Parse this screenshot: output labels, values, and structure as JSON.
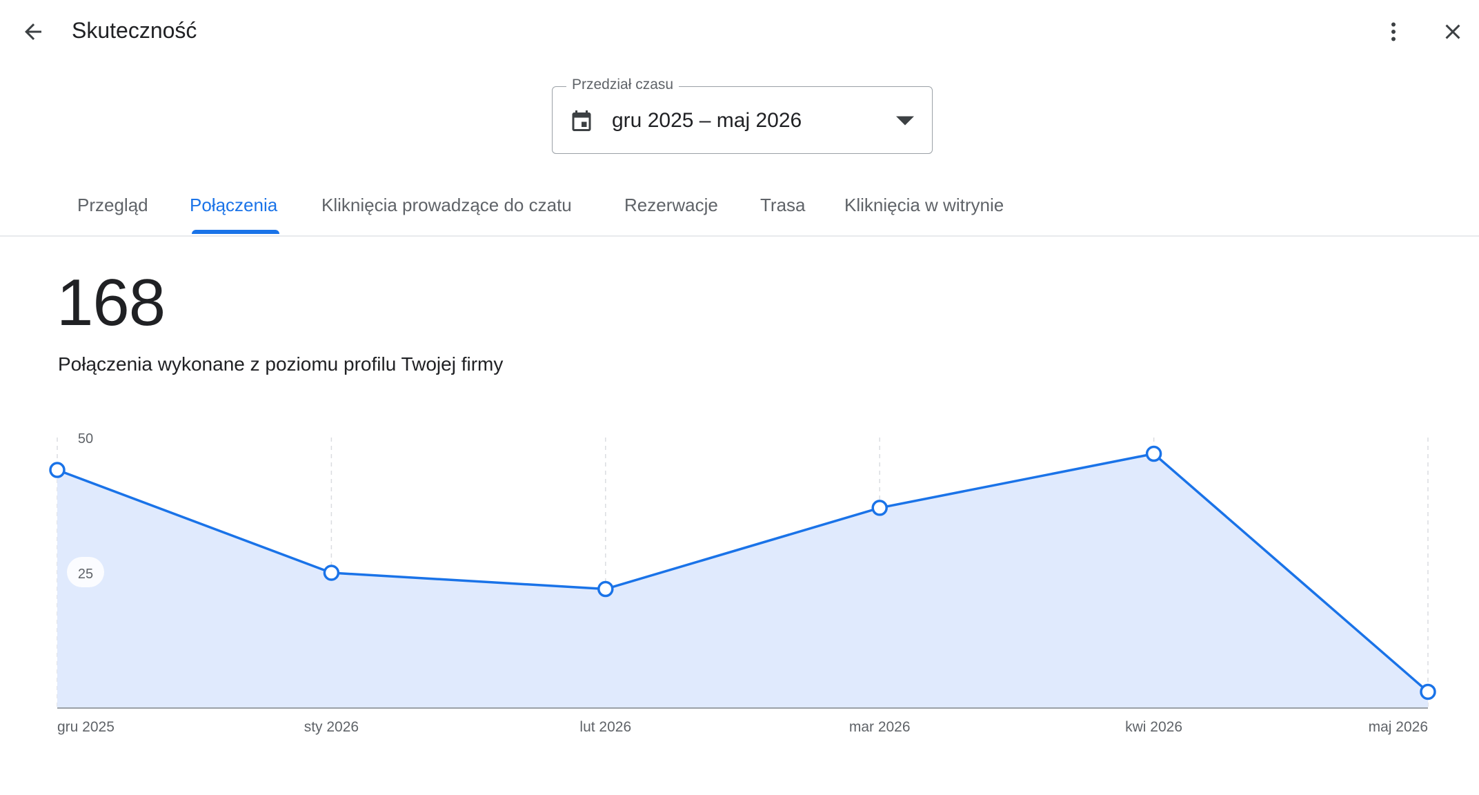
{
  "header": {
    "title": "Skuteczność",
    "back_icon": "arrow-back-icon",
    "more_icon": "more-vert-icon",
    "close_icon": "close-icon"
  },
  "date_range": {
    "legend": "Przedział czasu",
    "value": "gru 2025 – maj 2026",
    "icon": "calendar-icon"
  },
  "tabs": [
    {
      "label": "Przegląd",
      "active": false
    },
    {
      "label": "Połączenia",
      "active": true
    },
    {
      "label": "Kliknięcia prowadzące do czatu",
      "active": false
    },
    {
      "label": "Rezerwacje",
      "active": false
    },
    {
      "label": "Trasa",
      "active": false
    },
    {
      "label": "Kliknięcia w witrynie",
      "active": false
    }
  ],
  "summary": {
    "total": "168",
    "caption": "Połączenia wykonane z poziomu profilu Twojej firmy"
  },
  "colors": {
    "accent": "#1a73e8",
    "area_fill": "#e0eafd",
    "text_primary": "#202124",
    "text_secondary": "#5f6368"
  },
  "chart_data": {
    "type": "area",
    "categories": [
      "gru 2025",
      "sty 2026",
      "lut 2026",
      "mar 2026",
      "kwi 2026",
      "maj 2026"
    ],
    "values": [
      44,
      25,
      22,
      37,
      47,
      3
    ],
    "yticks": [
      "25",
      "50"
    ],
    "ylim": [
      0,
      50
    ],
    "grid": "vertical dashed",
    "legend": "none"
  }
}
